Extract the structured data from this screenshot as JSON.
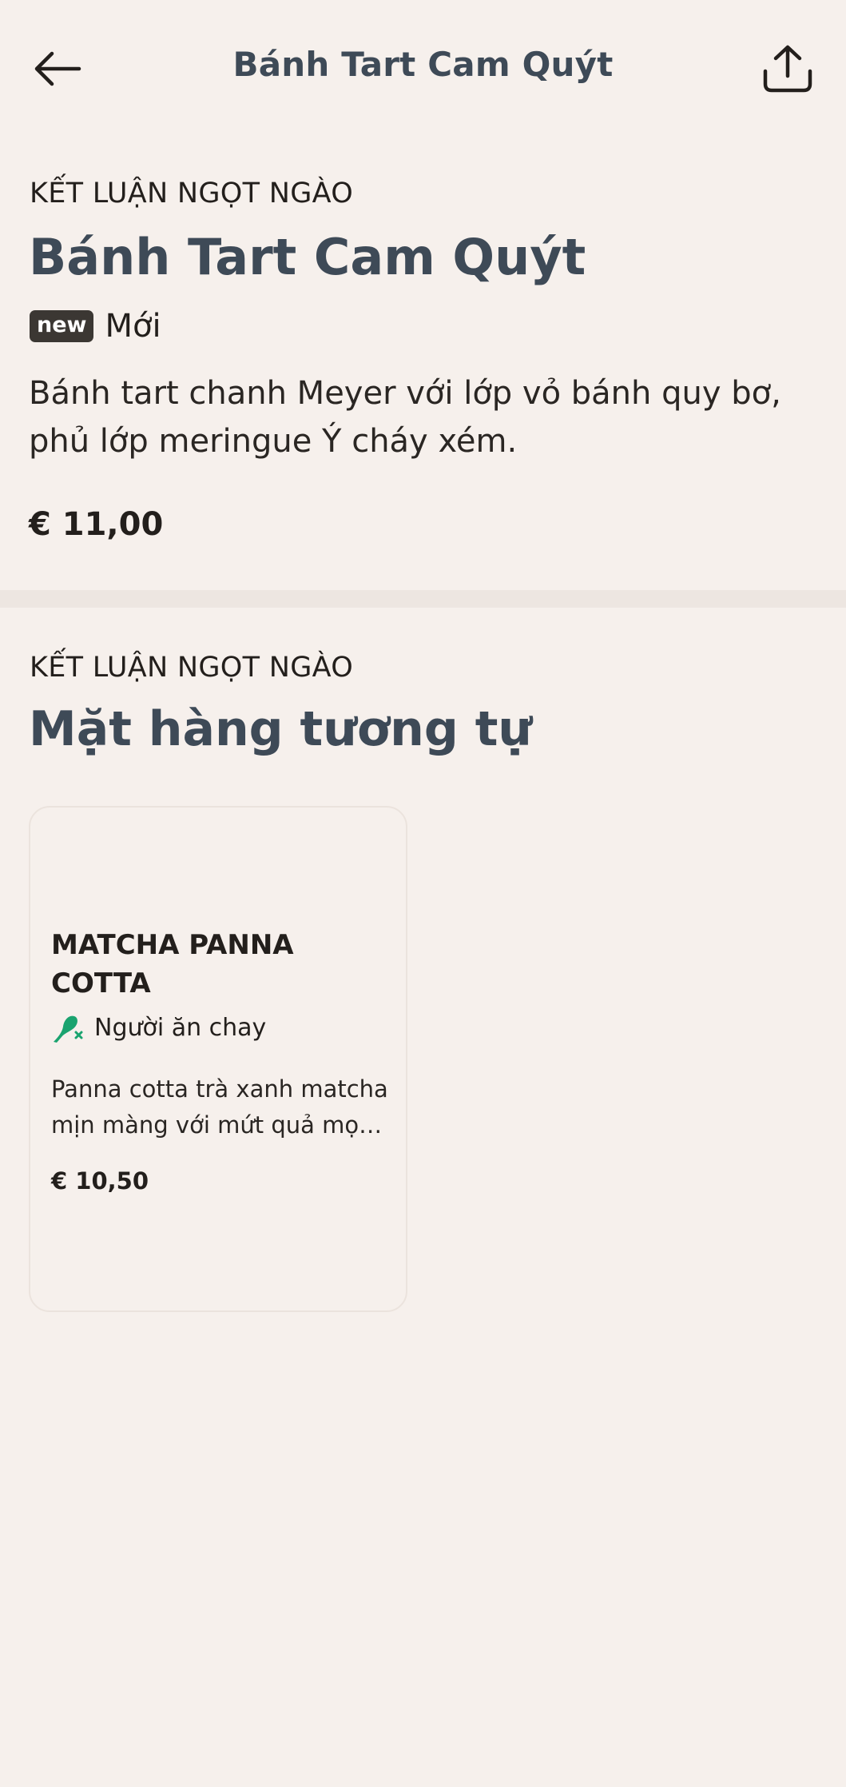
{
  "header": {
    "title": "Bánh Tart Cam Quýt",
    "back_icon": "arrow-left-icon",
    "share_icon": "share-icon"
  },
  "product": {
    "category": "KẾT LUẬN NGỌT NGÀO",
    "name": "Bánh Tart Cam Quýt",
    "badge": "new",
    "badge_label": "Mới",
    "description": "Bánh tart chanh Meyer với lớp vỏ bánh quy bơ, phủ lớp meringue Ý cháy xém.",
    "price": "€ 11,00"
  },
  "similar": {
    "category": "KẾT LUẬN NGỌT NGÀO",
    "title": "Mặt hàng tương tự",
    "items": [
      {
        "name": "MATCHA PANNA COTTA",
        "diet_label": "Người ăn chay",
        "diet_icon": "vegetarian-icon",
        "description": "Panna cotta trà xanh matcha mịn màng với mứt quả mọng tươi.",
        "price": "€ 10,50"
      }
    ]
  },
  "colors": {
    "background": "#f6f0ec",
    "heading": "#3e4a57",
    "text": "#231f1c",
    "badge": "#3b3733",
    "vegetarian_green": "#1aa36f",
    "divider": "#ede6e1"
  }
}
